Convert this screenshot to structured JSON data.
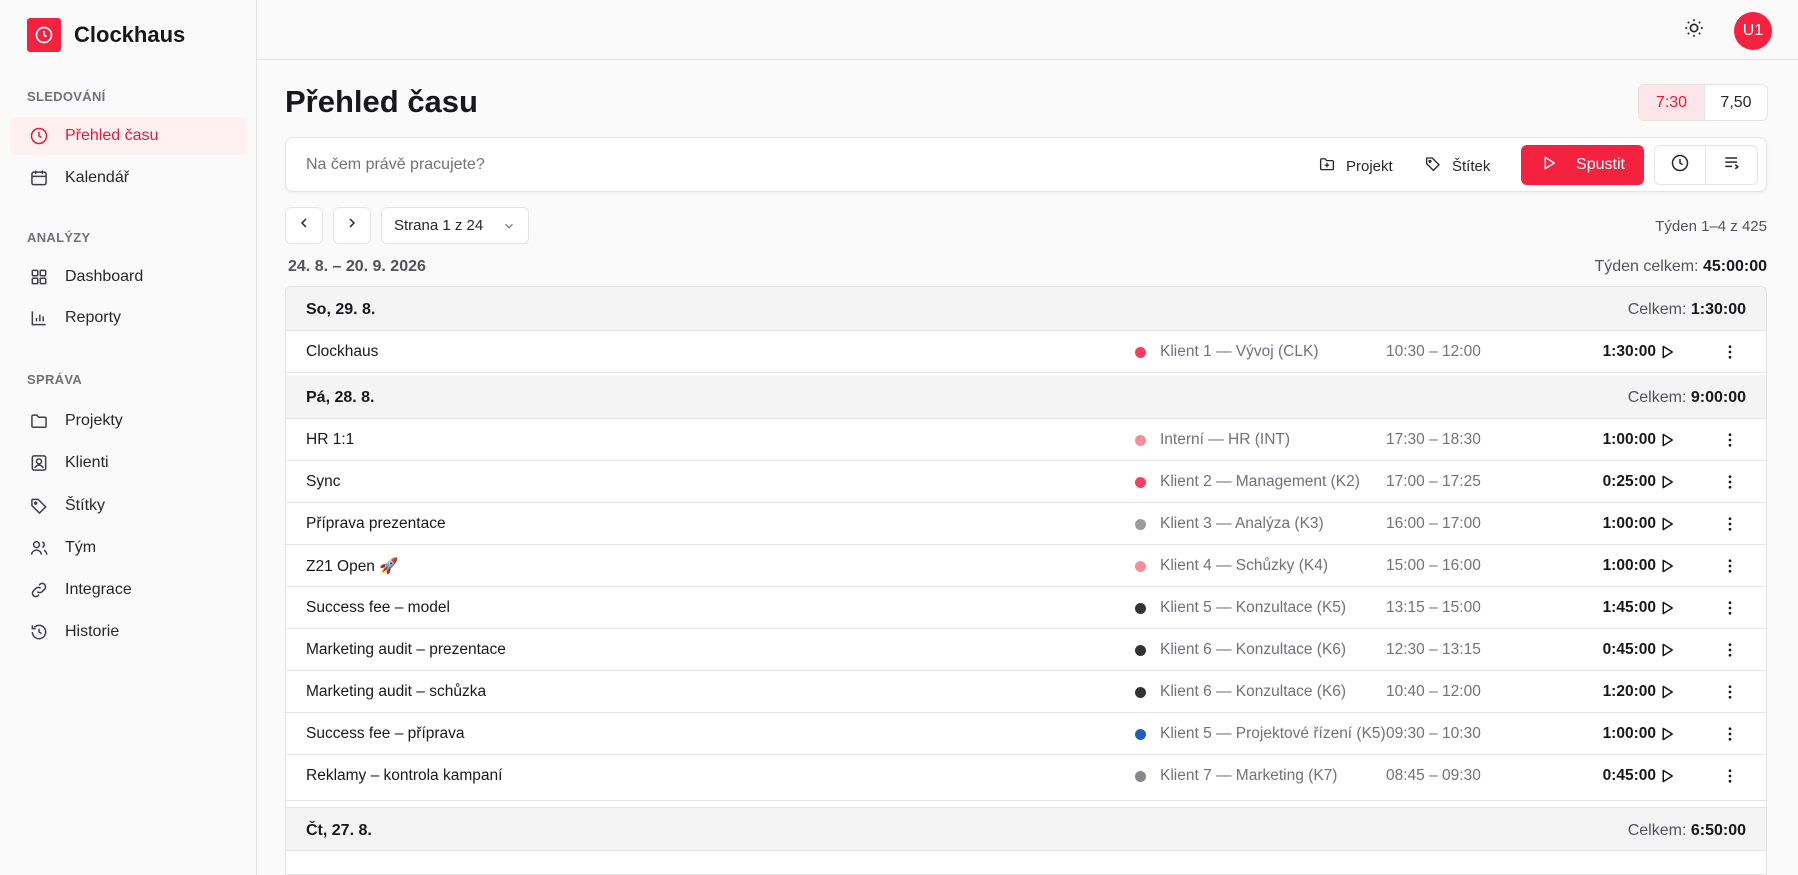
{
  "app": {
    "name": "Clockhaus",
    "user_initials": "U1"
  },
  "colors": {
    "accent": "#f4213f",
    "accent_soft": "#fff0f2"
  },
  "sidebar": {
    "sections": [
      {
        "title": "SLEDOVÁNÍ",
        "items": [
          {
            "label": "Přehled času",
            "icon": "clock-icon",
            "active": true
          },
          {
            "label": "Kalendář",
            "icon": "calendar-icon"
          }
        ]
      },
      {
        "title": "ANALÝZY",
        "items": [
          {
            "label": "Dashboard",
            "icon": "grid-icon"
          },
          {
            "label": "Reporty",
            "icon": "bar-chart-icon"
          }
        ]
      },
      {
        "title": "SPRÁVA",
        "items": [
          {
            "label": "Projekty",
            "icon": "folder-icon"
          },
          {
            "label": "Klienti",
            "icon": "contact-icon"
          },
          {
            "label": "Štítky",
            "icon": "tag-icon"
          },
          {
            "label": "Tým",
            "icon": "users-icon"
          },
          {
            "label": "Integrace",
            "icon": "link-icon"
          },
          {
            "label": "Historie",
            "icon": "history-icon"
          }
        ]
      }
    ]
  },
  "main": {
    "title": "Přehled času",
    "format_toggle": {
      "active": "7:30",
      "other": "7,50"
    },
    "tracker": {
      "placeholder": "Na čem právě pracujete?",
      "project_label": "Projekt",
      "tag_label": "Štítek",
      "start_label": "Spustit"
    },
    "pager": {
      "page_label": "Strana 1 z 24",
      "week_range": "Týden 1–4 z 425"
    },
    "date_range": "24. 8. – 20. 9. 2026",
    "week_total": {
      "label": "Týden celkem:",
      "value": "45:00:00"
    },
    "total_label": "Celkem:",
    "days": [
      {
        "name": "So, 29. 8.",
        "total": "1:30:00",
        "entries": [
          {
            "desc": "Clockhaus",
            "project": "Klient 1 — Vývoj (CLK)",
            "color": "#f43f5e",
            "range": "10:30 – 12:00",
            "duration": "1:30:00"
          }
        ]
      },
      {
        "name": "Pá, 28. 8.",
        "total": "9:00:00",
        "entries": [
          {
            "desc": "HR 1:1",
            "project": "Interní — HR (INT)",
            "color": "#fb8b99",
            "range": "17:30 – 18:30",
            "duration": "1:00:00"
          },
          {
            "desc": "Sync",
            "project": "Klient 2 — Management (K2)",
            "color": "#f43f5e",
            "range": "17:00 – 17:25",
            "duration": "0:25:00"
          },
          {
            "desc": "Příprava prezentace",
            "project": "Klient 3 — Analýza (K3)",
            "color": "#9a9aa0",
            "range": "16:00 – 17:00",
            "duration": "1:00:00"
          },
          {
            "desc": "Z21 Open 🚀",
            "project": "Klient 4 — Schůzky (K4)",
            "color": "#fb8b99",
            "range": "15:00 – 16:00",
            "duration": "1:00:00"
          },
          {
            "desc": "Success fee – model",
            "project": "Klient 5 — Konzultace (K5)",
            "color": "#333336",
            "range": "13:15 – 15:00",
            "duration": "1:45:00"
          },
          {
            "desc": "Marketing audit – prezentace",
            "project": "Klient 6 — Konzultace (K6)",
            "color": "#333336",
            "range": "12:30 – 13:15",
            "duration": "0:45:00"
          },
          {
            "desc": "Marketing audit – schůzka",
            "project": "Klient 6 — Konzultace (K6)",
            "color": "#333336",
            "range": "10:40 – 12:00",
            "duration": "1:20:00"
          },
          {
            "desc": "Success fee – příprava",
            "project": "Klient 5 — Projektové řízení (K5)",
            "color": "#1f5fb8",
            "range": "09:30 – 10:30",
            "duration": "1:00:00"
          },
          {
            "desc": "Reklamy – kontrola kampaní",
            "project": "Klient 7 — Marketing (K7)",
            "color": "#85858b",
            "range": "08:45 – 09:30",
            "duration": "0:45:00"
          }
        ]
      },
      {
        "name": "Čt, 27. 8.",
        "total": "6:50:00",
        "entries": []
      }
    ]
  }
}
